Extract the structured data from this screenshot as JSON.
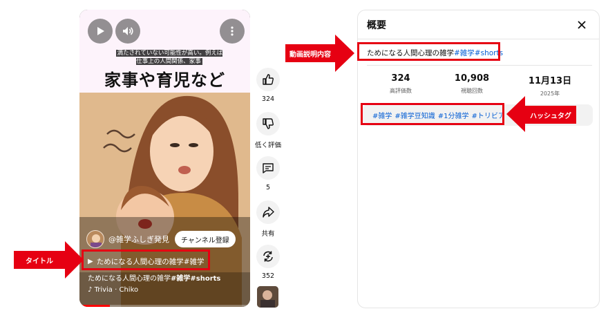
{
  "short": {
    "caption_small": "満たされていない可能性が高い。例えば仕事上の人間関係、家事",
    "caption_big": "家事や育児など",
    "channel_name": "@雑学ふしぎ発見",
    "subscribe_label": "チャンネル登録",
    "title": "ためになる人間心理の雑学#雑学",
    "description_prefix": "ためになる人間心理の雑学",
    "description_tags": "#雑学#shorts",
    "music": "Trivia · Chiko",
    "progress": 0.18
  },
  "actions": {
    "like_count": "324",
    "dislike_label": "低く評価",
    "comment_count": "5",
    "share_label": "共有",
    "remix_count": "352"
  },
  "panel": {
    "title": "概要",
    "desc_text": "ためになる人間心理の雑学",
    "desc_tags": "#雑学#shorts",
    "stats": [
      {
        "value": "324",
        "label": "高評価数"
      },
      {
        "value": "10,908",
        "label": "視聴回数"
      },
      {
        "value": "11月13日",
        "label": "2025年"
      }
    ],
    "hashtags": [
      "#雑学",
      "#雑学豆知識",
      "#1分雑学",
      "#トリビア"
    ]
  },
  "annotations": {
    "description": "動画説明内容",
    "hashtag": "ハッシュタグ",
    "title": "タイトル"
  },
  "colors": {
    "accent_red": "#e60012",
    "link_blue": "#065fd4",
    "progress_red": "#ff0000"
  },
  "icons": [
    "play-icon",
    "volume-icon",
    "more-vert-icon",
    "thumb-up-icon",
    "thumb-down-icon",
    "comment-icon",
    "share-icon",
    "remix-icon",
    "close-icon",
    "music-note-icon"
  ]
}
